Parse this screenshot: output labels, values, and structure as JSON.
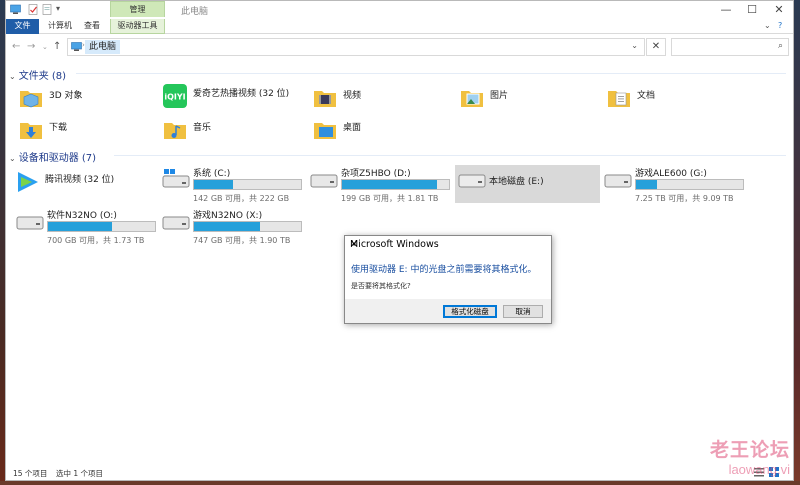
{
  "window": {
    "title": "此电脑",
    "context_tab": "管理",
    "tabs": {
      "file": "文件",
      "computer": "计算机",
      "view": "查看",
      "drive_tools": "驱动器工具"
    },
    "controls": {
      "minimize": "—",
      "maximize": "☐",
      "close": "✕"
    }
  },
  "address": {
    "path": "此电脑",
    "clear": "✕",
    "search_placeholder": ""
  },
  "groups": {
    "folders": {
      "label": "文件夹 (8)"
    },
    "devices": {
      "label": "设备和驱动器 (7)"
    }
  },
  "folders": [
    {
      "label": "3D 对象",
      "icon": "3d-objects-folder-icon"
    },
    {
      "label": "爱奇艺热播视频 (32 位)",
      "icon": "iqiyi-app-icon",
      "logo_text": "iQIYI"
    },
    {
      "label": "视频",
      "icon": "videos-folder-icon"
    },
    {
      "label": "图片",
      "icon": "pictures-folder-icon"
    },
    {
      "label": "文档",
      "icon": "documents-folder-icon"
    },
    {
      "label": "下载",
      "icon": "downloads-folder-icon"
    },
    {
      "label": "音乐",
      "icon": "music-folder-icon"
    },
    {
      "label": "桌面",
      "icon": "desktop-folder-icon"
    }
  ],
  "devices": [
    {
      "label": "腾讯视频 (32 位)",
      "icon": "tencent-video-icon"
    },
    {
      "label": "系统 (C:)",
      "used_fraction": 0.36,
      "capacity": "142 GB 可用，共 222 GB",
      "icon": "windows-drive-icon"
    },
    {
      "label": "杂项Z5HBO (D:)",
      "used_fraction": 0.89,
      "capacity": "199 GB 可用，共 1.81 TB",
      "icon": "hard-drive-icon"
    },
    {
      "label": "本地磁盘 (E:)",
      "icon": "hard-drive-icon",
      "selected": true
    },
    {
      "label": "游戏ALE600 (G:)",
      "used_fraction": 0.2,
      "capacity": "7.25 TB 可用，共 9.09 TB",
      "icon": "hard-drive-icon"
    },
    {
      "label": "软件N32NO (O:)",
      "used_fraction": 0.6,
      "capacity": "700 GB 可用，共 1.73 TB",
      "icon": "hard-drive-icon"
    },
    {
      "label": "游戏N32NO (X:)",
      "used_fraction": 0.62,
      "capacity": "747 GB 可用，共 1.90 TB",
      "icon": "hard-drive-icon"
    }
  ],
  "status": {
    "count": "15 个项目",
    "selection": "选中 1 个项目"
  },
  "dialog": {
    "title": "Microsoft Windows",
    "close": "✕",
    "message": "使用驱动器 E: 中的光盘之前需要将其格式化。",
    "question": "是否要将其格式化?",
    "format_button": "格式化磁盘",
    "cancel_button": "取消"
  },
  "watermark": {
    "line1": "老王论坛",
    "line2": "laowang.vi"
  },
  "colors": {
    "accent": "#26a0da",
    "file_tab": "#1f5da8",
    "context_tab": "#cfe8b8",
    "group_text": "#1e3a8a"
  }
}
